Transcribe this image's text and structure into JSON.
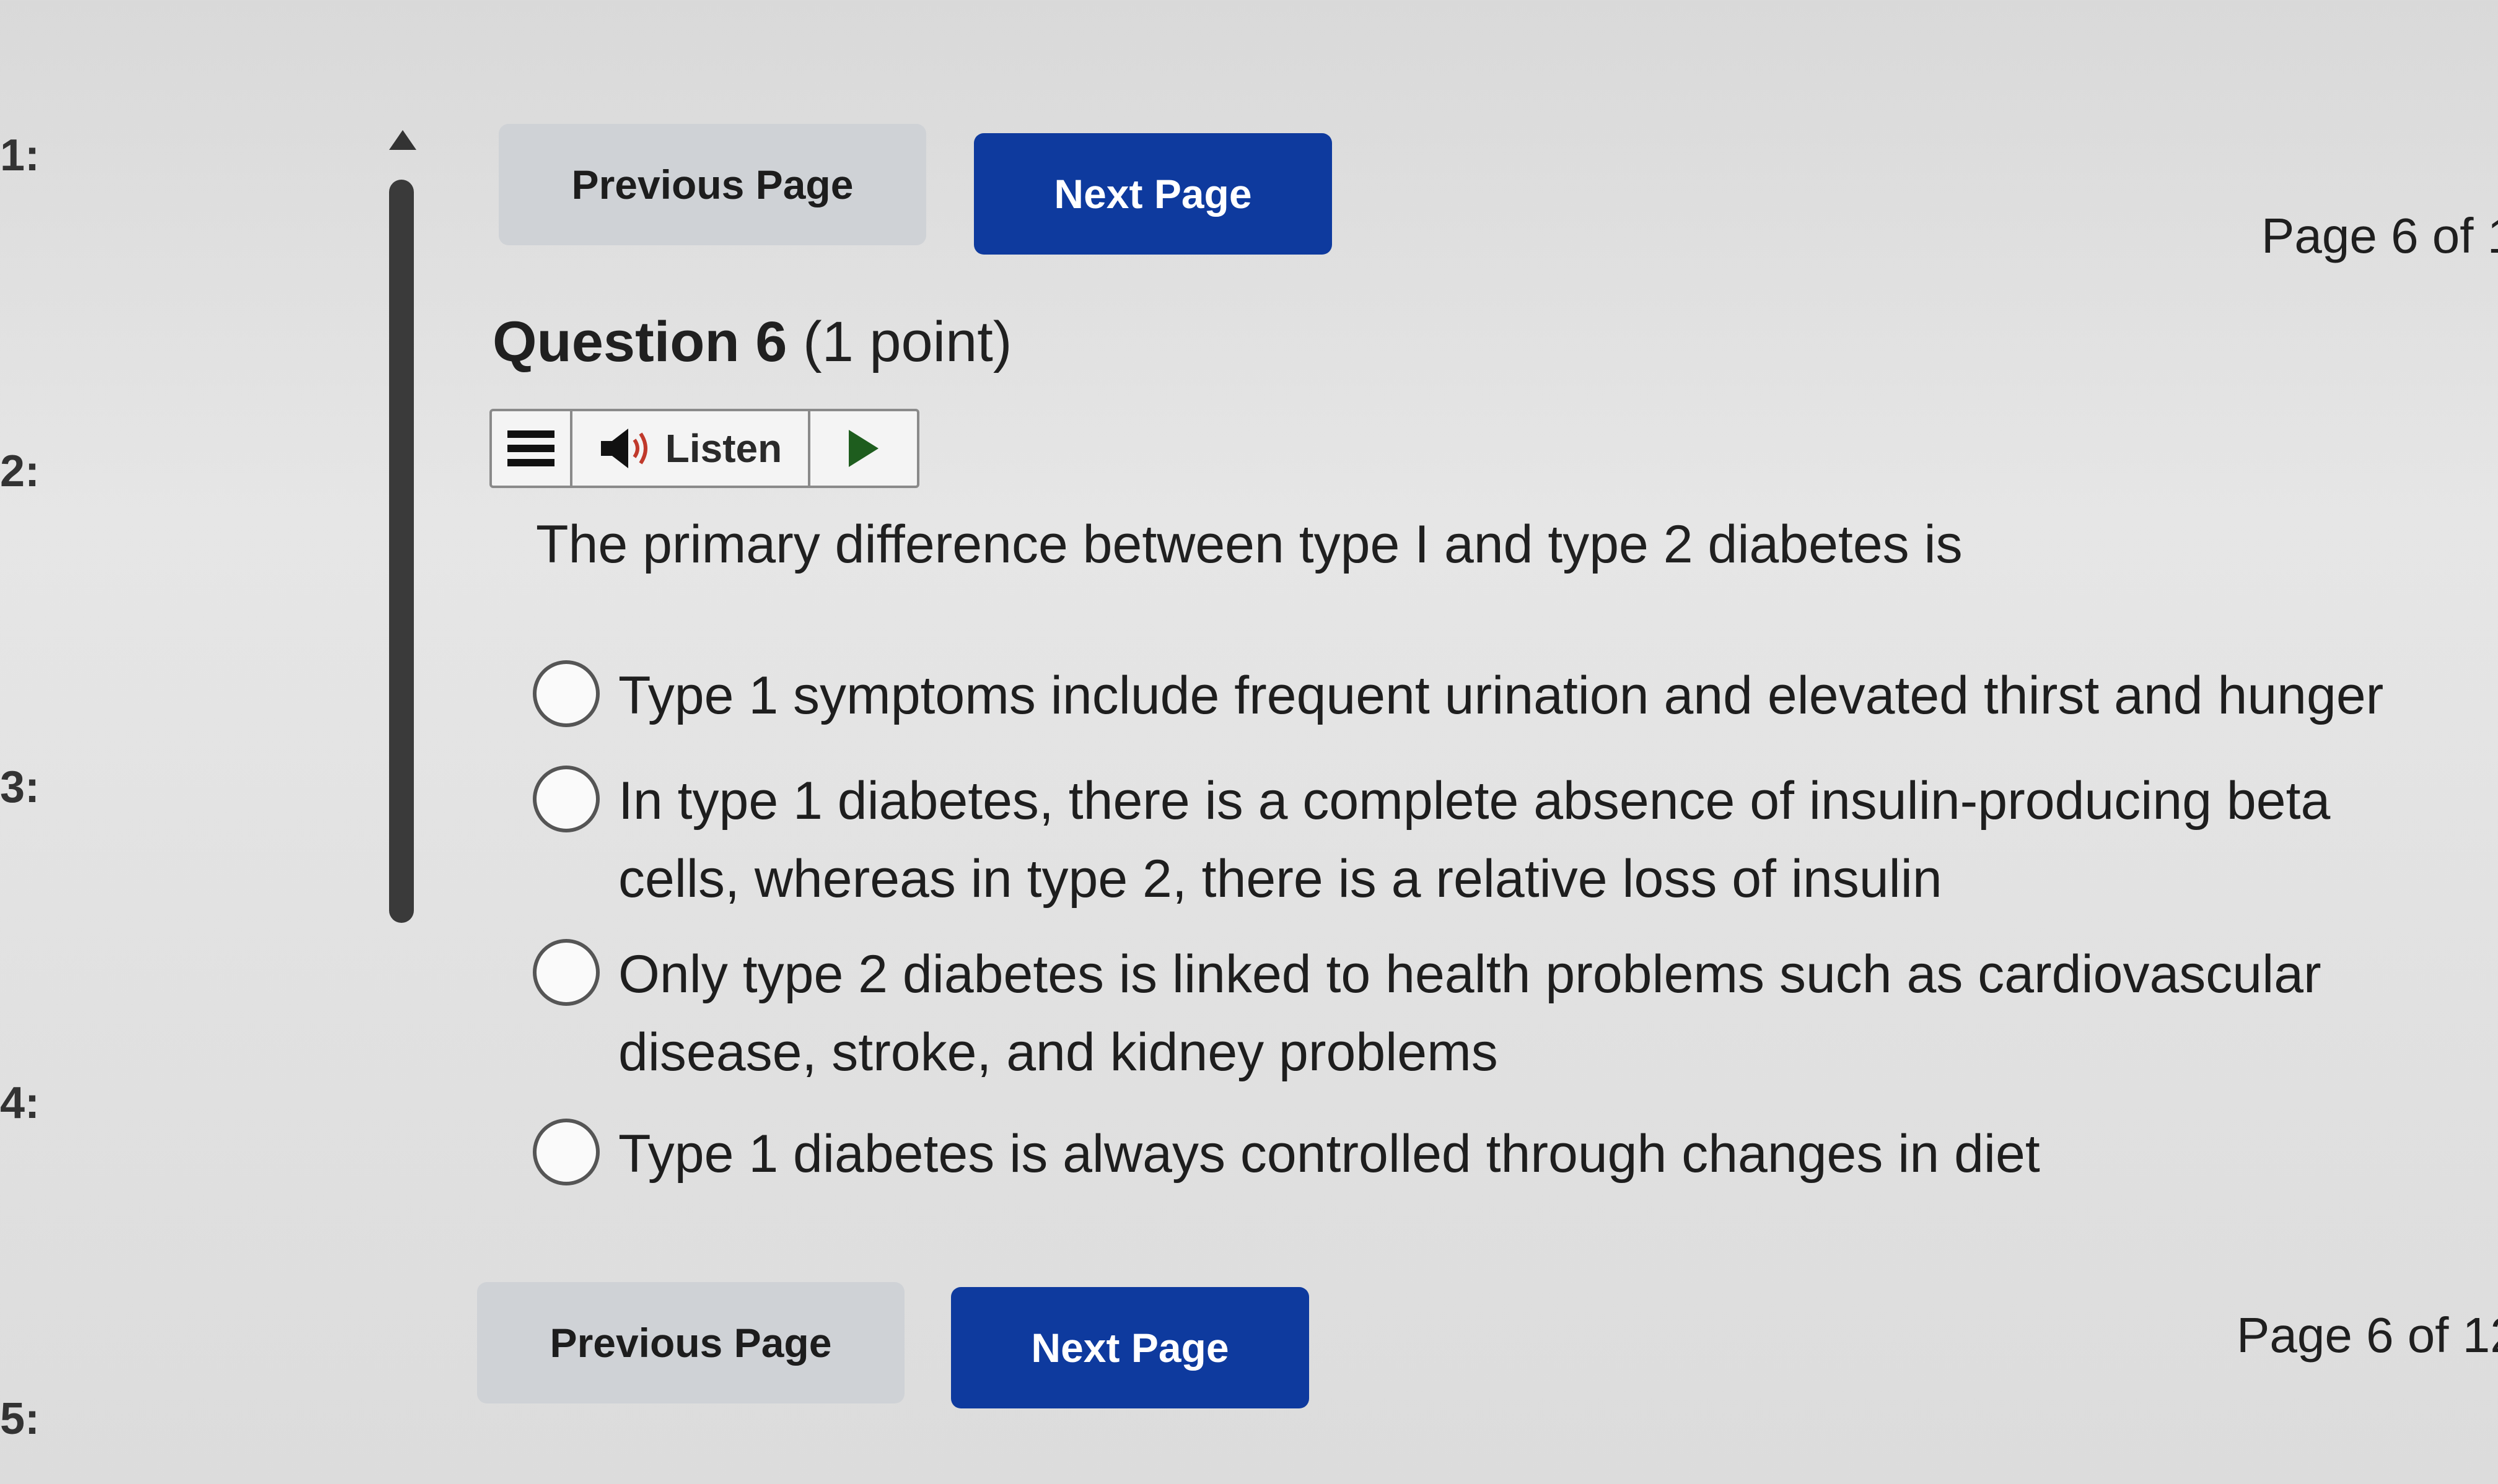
{
  "left_nav": {
    "items": [
      "1:",
      "2:",
      "3:",
      "4:",
      "5:"
    ]
  },
  "nav_top": {
    "previous_label": "Previous Page",
    "next_label": "Next Page",
    "page_indicator": "Page 6 of 1"
  },
  "nav_bottom": {
    "previous_label": "Previous Page",
    "next_label": "Next Page",
    "page_indicator": "Page 6 of 12"
  },
  "question": {
    "label": "Question 6",
    "points": "(1 point)",
    "text": "The primary difference between type I and type 2 diabetes is",
    "options": [
      {
        "label": "Type 1 symptoms include frequent urination and elevated thirst and hunger",
        "selected": false
      },
      {
        "label": "In type 1 diabetes, there is a complete absence of insulin-producing beta cells, whereas in type 2, there is a relative loss of insulin",
        "selected": false
      },
      {
        "label": "Only type 2 diabetes is linked to health problems such as cardiovascular disease, stroke, and kidney problems",
        "selected": false
      },
      {
        "label": "Type 1 diabetes is always controlled through changes in diet",
        "selected": false
      }
    ]
  },
  "listen_toolbar": {
    "menu_icon": "hamburger-menu-icon",
    "speaker_icon": "speaker-icon",
    "listen_label": "Listen",
    "play_icon": "play-icon"
  },
  "colors": {
    "next_button": "#0e3a9e",
    "previous_button": "#cfd2d6",
    "play_icon": "#1e5d1e"
  }
}
